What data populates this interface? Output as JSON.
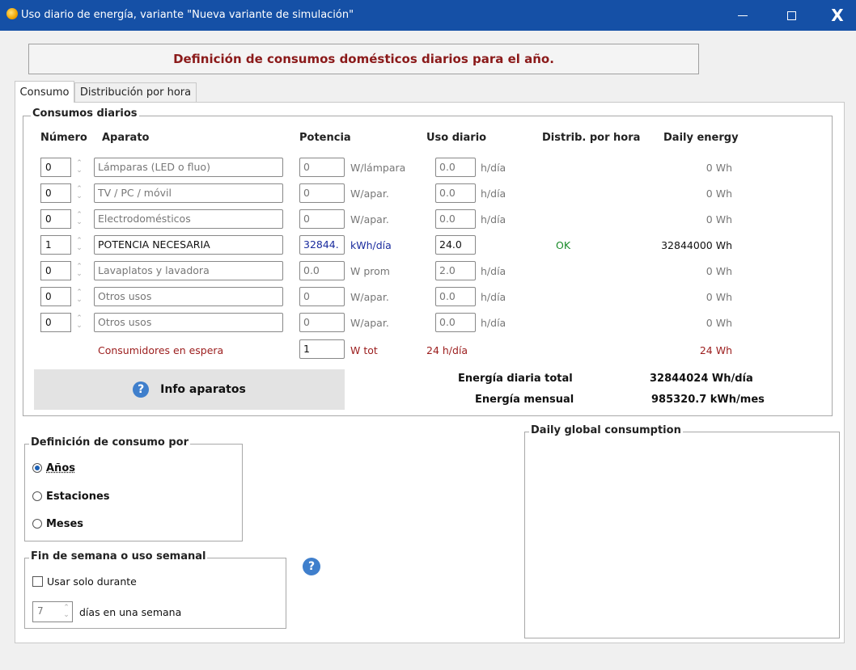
{
  "window": {
    "title": "Uso diario de energía, variante \"Nueva variante de simulación\"",
    "minimize": "—",
    "maximize": "",
    "close": "X"
  },
  "header": {
    "title": "Definición de consumos domésticos diarios para el año."
  },
  "tabs": [
    {
      "label": "Consumo"
    },
    {
      "label": "Distribución por hora"
    }
  ],
  "consumos": {
    "group_label": "Consumos diarios",
    "headers": {
      "numero": "Número",
      "aparato": "Aparato",
      "potencia": "Potencia",
      "uso": "Uso diario",
      "distrib": "Distrib. por hora",
      "energy": "Daily energy"
    },
    "rows": [
      {
        "numero": "0",
        "aparato": "Lámparas (LED o fluo)",
        "potencia": "0",
        "unit": "W/lámpara",
        "uso": "0.0",
        "uso_unit": "h/día",
        "distrib": "",
        "energy": "0 Wh"
      },
      {
        "numero": "0",
        "aparato": "TV / PC / móvil",
        "potencia": "0",
        "unit": "W/apar.",
        "uso": "0.0",
        "uso_unit": "h/día",
        "distrib": "",
        "energy": "0 Wh"
      },
      {
        "numero": "0",
        "aparato": "Electrodomésticos",
        "potencia": "0",
        "unit": "W/apar.",
        "uso": "0.0",
        "uso_unit": "h/día",
        "distrib": "",
        "energy": "0 Wh"
      },
      {
        "numero": "1",
        "aparato": "POTENCIA NECESARIA",
        "potencia": "32844.",
        "unit": "kWh/día",
        "uso": "24.0",
        "uso_unit": "",
        "distrib": "OK",
        "energy": "32844000 Wh"
      },
      {
        "numero": "0",
        "aparato": "Lavaplatos y lavadora",
        "potencia": "0.0",
        "unit": "W prom",
        "uso": "2.0",
        "uso_unit": "h/día",
        "distrib": "",
        "energy": "0 Wh"
      },
      {
        "numero": "0",
        "aparato": "Otros usos",
        "potencia": "0",
        "unit": "W/apar.",
        "uso": "0.0",
        "uso_unit": "h/día",
        "distrib": "",
        "energy": "0 Wh"
      },
      {
        "numero": "0",
        "aparato": "Otros usos",
        "potencia": "0",
        "unit": "W/apar.",
        "uso": "0.0",
        "uso_unit": "h/día",
        "distrib": "",
        "energy": "0 Wh"
      }
    ],
    "standby": {
      "label": "Consumidores en espera",
      "value": "1",
      "unit": "W tot",
      "uso": "24 h/día",
      "energy": "24 Wh"
    },
    "info_button": "Info aparatos",
    "totals": {
      "daily_label": "Energía diaria total",
      "daily_value": "32844024 Wh/día",
      "monthly_label": "Energía mensual",
      "monthly_value": "985320.7 kWh/mes"
    }
  },
  "definicion": {
    "group_label": "Definición de consumo por",
    "options": [
      "Años",
      "Estaciones",
      "Meses"
    ],
    "selected": "Años"
  },
  "fin_semana": {
    "group_label": "Fin de semana o uso semanal",
    "checkbox_label": "Usar solo durante",
    "days_value": "7",
    "days_label": "días en una semana"
  },
  "daily_global": {
    "group_label": "Daily global consumption"
  },
  "help_icon": "?"
}
